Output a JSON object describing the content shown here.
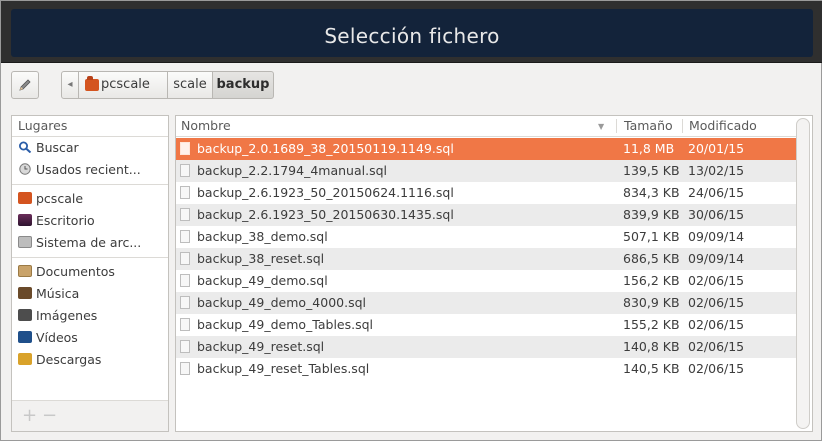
{
  "window": {
    "title": "Selección fichero"
  },
  "pathbar": {
    "edit_icon": "pencil-icon",
    "back_arrow": "◂",
    "crumbs": [
      {
        "label": "pcscale",
        "icon": "home-folder-icon"
      },
      {
        "label": "scale"
      },
      {
        "label": "backup",
        "active": true
      }
    ]
  },
  "sidebar": {
    "header": "Lugares",
    "groups": [
      [
        {
          "label": "Buscar",
          "icon": "search-icon"
        },
        {
          "label": "Usados recient...",
          "icon": "recent-icon"
        }
      ],
      [
        {
          "label": "pcscale",
          "icon": "home-folder-icon"
        },
        {
          "label": "Escritorio",
          "icon": "desktop-icon"
        },
        {
          "label": "Sistema de arc...",
          "icon": "drive-icon"
        }
      ],
      [
        {
          "label": "Documentos",
          "icon": "documents-icon"
        },
        {
          "label": "Música",
          "icon": "music-icon"
        },
        {
          "label": "Imágenes",
          "icon": "pictures-icon"
        },
        {
          "label": "Vídeos",
          "icon": "videos-icon"
        },
        {
          "label": "Descargas",
          "icon": "downloads-icon"
        }
      ]
    ],
    "add_label": "+",
    "remove_label": "−"
  },
  "filelist": {
    "columns": {
      "name": "Nombre",
      "size": "Tamaño",
      "modified": "Modificado"
    },
    "rows": [
      {
        "name": "backup_2.0.1689_38_20150119.1149.sql",
        "size": "11,8 MB",
        "date": "20/01/15",
        "selected": true
      },
      {
        "name": "backup_2.2.1794_4manual.sql",
        "size": "139,5 KB",
        "date": "13/02/15"
      },
      {
        "name": "backup_2.6.1923_50_20150624.1116.sql",
        "size": "834,3 KB",
        "date": "24/06/15"
      },
      {
        "name": "backup_2.6.1923_50_20150630.1435.sql",
        "size": "839,9 KB",
        "date": "30/06/15"
      },
      {
        "name": "backup_38_demo.sql",
        "size": "507,1 KB",
        "date": "09/09/14"
      },
      {
        "name": "backup_38_reset.sql",
        "size": "686,5 KB",
        "date": "09/09/14"
      },
      {
        "name": "backup_49_demo.sql",
        "size": "156,2 KB",
        "date": "02/06/15"
      },
      {
        "name": "backup_49_demo_4000.sql",
        "size": "830,9 KB",
        "date": "02/06/15"
      },
      {
        "name": "backup_49_demo_Tables.sql",
        "size": "155,2 KB",
        "date": "02/06/15"
      },
      {
        "name": "backup_49_reset.sql",
        "size": "140,8 KB",
        "date": "02/06/15"
      },
      {
        "name": "backup_49_reset_Tables.sql",
        "size": "140,5 KB",
        "date": "02/06/15"
      }
    ]
  },
  "colors": {
    "selection": "#f07746",
    "titlebar": "#13233a",
    "folder": "#d4541f"
  }
}
